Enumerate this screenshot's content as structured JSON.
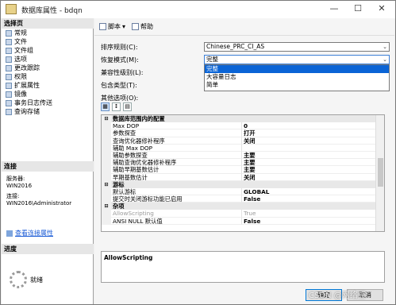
{
  "window": {
    "title": "数据库属性 - bdqn"
  },
  "sidebar": {
    "select_page_header": "选择页",
    "items": [
      "常规",
      "文件",
      "文件组",
      "选项",
      "更改跟踪",
      "权限",
      "扩展属性",
      "镜像",
      "事务日志传送",
      "查询存储"
    ],
    "connection_header": "连接",
    "server_label": "服务器:",
    "server_value": "WIN2016",
    "connection_label": "连接:",
    "connection_value": "WIN2016\\Administrator",
    "view_connection_link": "查看连接属性",
    "progress_header": "进度",
    "progress_status": "就绪"
  },
  "toolbar": {
    "script_label": "脚本",
    "help_label": "帮助"
  },
  "form": {
    "collation_label": "排序规则(C):",
    "collation_value": "Chinese_PRC_CI_AS",
    "recovery_label": "恢复模式(M):",
    "recovery_value": "完整",
    "compat_label": "兼容性级别(L):",
    "containment_label": "包含类型(T):",
    "other_label": "其他选项(O):",
    "recovery_options": [
      "完整",
      "大容量日志",
      "简单"
    ]
  },
  "grid": {
    "rows": [
      {
        "type": "cat",
        "name": "数据库范围内的配置"
      },
      {
        "type": "row",
        "name": "Max DOP",
        "value": "0"
      },
      {
        "type": "row",
        "name": "参数探查",
        "value": "打开"
      },
      {
        "type": "row",
        "name": "查询优化器修补程序",
        "value": "关闭"
      },
      {
        "type": "row",
        "name": "辅助 Max DOP",
        "value": ""
      },
      {
        "type": "row",
        "name": "辅助参数探查",
        "value": "主要"
      },
      {
        "type": "row",
        "name": "辅助查询优化器修补程序",
        "value": "主要"
      },
      {
        "type": "row",
        "name": "辅助早期基数估计",
        "value": "主要"
      },
      {
        "type": "row",
        "name": "早期基数估计",
        "value": "关闭"
      },
      {
        "type": "cat",
        "name": "游标"
      },
      {
        "type": "row",
        "name": "默认游标",
        "value": "GLOBAL"
      },
      {
        "type": "row",
        "name": "提交时关闭游标功能已启用",
        "value": "False"
      },
      {
        "type": "cat",
        "name": "杂项"
      },
      {
        "type": "dim",
        "name": "AllowScripting",
        "value": "True"
      },
      {
        "type": "row",
        "name": "ANSI NULL 默认值",
        "value": "False"
      }
    ]
  },
  "description": {
    "text": "AllowScripting"
  },
  "buttons": {
    "ok": "确定",
    "cancel": "取消"
  },
  "watermark": "CSDN @网络豆"
}
